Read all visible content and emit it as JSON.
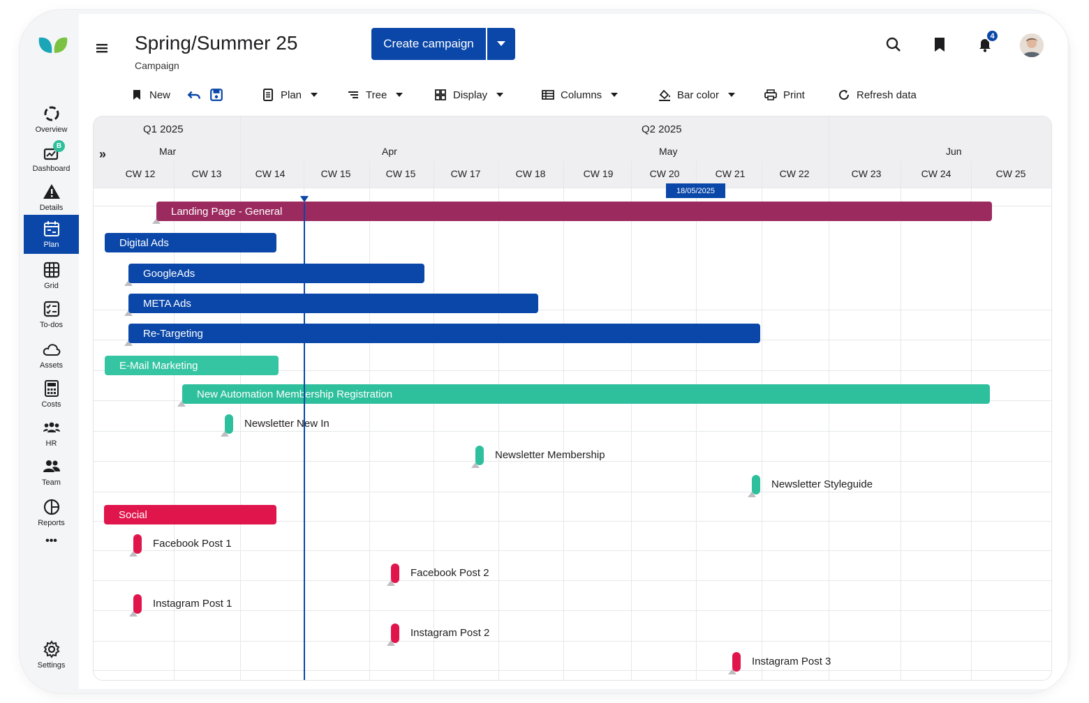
{
  "sidebar": {
    "items": [
      {
        "label": "Overview",
        "icon": "overview-icon"
      },
      {
        "label": "Dashboard",
        "icon": "dashboard-icon",
        "badge": "B"
      },
      {
        "label": "Details",
        "icon": "details-icon"
      },
      {
        "label": "Plan",
        "icon": "plan-icon",
        "active": true
      },
      {
        "label": "Grid",
        "icon": "grid-icon"
      },
      {
        "label": "To-dos",
        "icon": "todos-icon"
      },
      {
        "label": "Assets",
        "icon": "cloud-icon"
      },
      {
        "label": "Costs",
        "icon": "calculator-icon"
      },
      {
        "label": "HR",
        "icon": "hr-icon"
      },
      {
        "label": "Team",
        "icon": "team-icon"
      },
      {
        "label": "Reports",
        "icon": "reports-icon"
      }
    ],
    "more_label": "•••",
    "settings_label": "Settings"
  },
  "header": {
    "title": "Spring/Summer 25",
    "subtitle": "Campaign",
    "create_label": "Create campaign",
    "notification_count": "4"
  },
  "toolbar": {
    "new_label": "New",
    "plan_label": "Plan",
    "tree_label": "Tree",
    "display_label": "Display",
    "columns_label": "Columns",
    "bar_color_label": "Bar color",
    "print_label": "Print",
    "refresh_label": "Refresh data"
  },
  "timeline": {
    "quarters": [
      "Q1 2025",
      "Q2 2025"
    ],
    "months": [
      "Mar",
      "Apr",
      "May",
      "Jun"
    ],
    "weeks": [
      "CW 12",
      "CW 13",
      "CW 14",
      "CW 15",
      "CW 15",
      "CW 17",
      "CW 18",
      "CW 19",
      "CW 20",
      "CW 21",
      "CW 22",
      "CW 23",
      "CW 24",
      "CW 25"
    ],
    "today_label": "18/05/2025"
  },
  "tasks": [
    {
      "type": "bar",
      "label": "Landing Page - General",
      "color": "#9b2a5f"
    },
    {
      "type": "bar",
      "label": "Digital Ads",
      "color": "#0a47a8"
    },
    {
      "type": "bar",
      "label": "GoogleAds",
      "color": "#0a47a8"
    },
    {
      "type": "bar",
      "label": "META Ads",
      "color": "#0a47a8"
    },
    {
      "type": "bar",
      "label": "Re-Targeting",
      "color": "#0a47a8"
    },
    {
      "type": "bar",
      "label": "E-Mail Marketing",
      "color": "#36c5a3"
    },
    {
      "type": "bar",
      "label": "New Automation Membership Registration",
      "color": "#2ebf9c"
    },
    {
      "type": "milestone",
      "label": "Newsletter New In",
      "color": "#2ebf9c"
    },
    {
      "type": "milestone",
      "label": "Newsletter Membership",
      "color": "#2ebf9c"
    },
    {
      "type": "milestone",
      "label": "Newsletter Styleguide",
      "color": "#2ebf9c"
    },
    {
      "type": "bar",
      "label": "Social",
      "color": "#e0154c"
    },
    {
      "type": "milestone",
      "label": "Facebook Post 1",
      "color": "#e0154c"
    },
    {
      "type": "milestone",
      "label": "Facebook Post 2",
      "color": "#e0154c"
    },
    {
      "type": "milestone",
      "label": "Instagram Post 1",
      "color": "#e0154c"
    },
    {
      "type": "milestone",
      "label": "Instagram Post 2",
      "color": "#e0154c"
    },
    {
      "type": "milestone",
      "label": "Instagram Post 3",
      "color": "#e0154c"
    }
  ],
  "colors": {
    "accent": "#0a47a8",
    "social": "#e0154c",
    "email": "#2ebf9c",
    "landing": "#9b2a5f"
  }
}
